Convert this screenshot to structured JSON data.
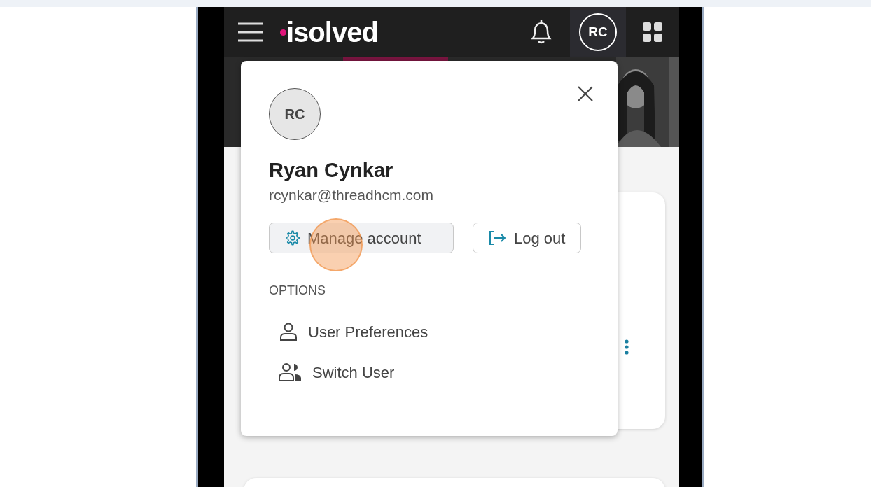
{
  "header": {
    "logo": "isolved",
    "avatar_initials": "RC"
  },
  "account_popup": {
    "avatar_initials": "RC",
    "name": "Ryan Cynkar",
    "email": "rcynkar@threadhcm.com",
    "buttons": [
      {
        "label": "Manage account",
        "kind": "manage"
      },
      {
        "label": "Log out",
        "kind": "logout"
      }
    ],
    "options_heading": "OPTIONS",
    "options": [
      {
        "label": "User Preferences",
        "kind": "preferences"
      },
      {
        "label": "Switch User",
        "kind": "switch"
      }
    ]
  }
}
